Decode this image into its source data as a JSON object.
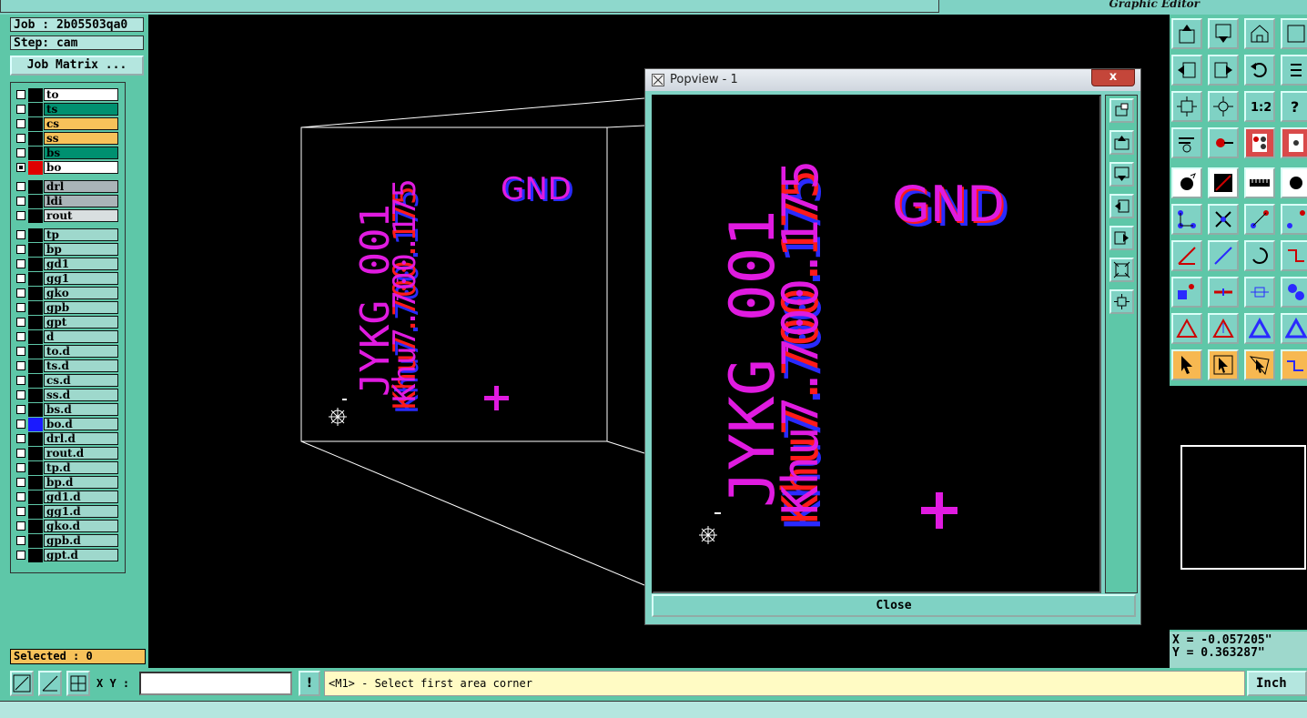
{
  "app": {
    "title": "Graphic Editor"
  },
  "job": {
    "job_label": "Job : 2b05503qa0",
    "step_label": "Step: cam",
    "matrix_button": "Job Matrix ..."
  },
  "layers": [
    {
      "name": "to",
      "bg": "#ffffff",
      "color": "#000000",
      "active": false
    },
    {
      "name": "ts",
      "bg": "#009070",
      "color": "#000000",
      "active": false
    },
    {
      "name": "cs",
      "bg": "#f7c25a",
      "color": "#000000",
      "active": false
    },
    {
      "name": "ss",
      "bg": "#f7c25a",
      "color": "#000000",
      "active": false
    },
    {
      "name": "bs",
      "bg": "#009070",
      "color": "#000000",
      "active": false
    },
    {
      "name": "bo",
      "bg": "#ffffff",
      "color": "#e00000",
      "active": true
    },
    {
      "name": "drl",
      "bg": "#aab4b8",
      "color": "#000000",
      "active": false
    },
    {
      "name": "ldi",
      "bg": "#aab4b8",
      "color": "#000000",
      "active": false
    },
    {
      "name": "rout",
      "bg": "#d9dfe0",
      "color": "#000000",
      "active": false
    },
    {
      "name": "tp",
      "bg": "#9ed8cc",
      "color": "#000000",
      "active": false
    },
    {
      "name": "bp",
      "bg": "#9ed8cc",
      "color": "#000000",
      "active": false
    },
    {
      "name": "gd1",
      "bg": "#9ed8cc",
      "color": "#000000",
      "active": false
    },
    {
      "name": "gg1",
      "bg": "#9ed8cc",
      "color": "#000000",
      "active": false
    },
    {
      "name": "gko",
      "bg": "#9ed8cc",
      "color": "#000000",
      "active": false
    },
    {
      "name": "gpb",
      "bg": "#9ed8cc",
      "color": "#000000",
      "active": false
    },
    {
      "name": "gpt",
      "bg": "#9ed8cc",
      "color": "#000000",
      "active": false
    },
    {
      "name": "d",
      "bg": "#9ed8cc",
      "color": "#000000",
      "active": false
    },
    {
      "name": "to.d",
      "bg": "#9ed8cc",
      "color": "#000000",
      "active": false
    },
    {
      "name": "ts.d",
      "bg": "#9ed8cc",
      "color": "#000000",
      "active": false
    },
    {
      "name": "cs.d",
      "bg": "#9ed8cc",
      "color": "#000000",
      "active": false
    },
    {
      "name": "ss.d",
      "bg": "#9ed8cc",
      "color": "#000000",
      "active": false
    },
    {
      "name": "bs.d",
      "bg": "#9ed8cc",
      "color": "#000000",
      "active": false
    },
    {
      "name": "bo.d",
      "bg": "#9ed8cc",
      "color": "#1a1aff",
      "active": false
    },
    {
      "name": "drl.d",
      "bg": "#9ed8cc",
      "color": "#000000",
      "active": false
    },
    {
      "name": "rout.d",
      "bg": "#9ed8cc",
      "color": "#000000",
      "active": false
    },
    {
      "name": "tp.d",
      "bg": "#9ed8cc",
      "color": "#000000",
      "active": false
    },
    {
      "name": "bp.d",
      "bg": "#9ed8cc",
      "color": "#000000",
      "active": false
    },
    {
      "name": "gd1.d",
      "bg": "#9ed8cc",
      "color": "#000000",
      "active": false
    },
    {
      "name": "gg1.d",
      "bg": "#9ed8cc",
      "color": "#000000",
      "active": false
    },
    {
      "name": "gko.d",
      "bg": "#9ed8cc",
      "color": "#000000",
      "active": false
    },
    {
      "name": "gpb.d",
      "bg": "#9ed8cc",
      "color": "#000000",
      "active": false
    },
    {
      "name": "gpt.d",
      "bg": "#9ed8cc",
      "color": "#000000",
      "active": false
    }
  ],
  "selected_label": "Selected : 0",
  "canvas": {
    "gnd_text": "GND",
    "part_text": "JYKG_001",
    "version_text": "Khu7.700.175"
  },
  "popview": {
    "title": "Popview - 1",
    "close_x": "x",
    "close_button": "Close"
  },
  "coords": {
    "x": "X = -0.057205\"",
    "y": "Y = 0.363287\""
  },
  "bottom": {
    "xy_label": "X Y :",
    "xy_value": "",
    "bang": "!",
    "status": "<M1> - Select first area corner",
    "units": "Inch"
  },
  "colors": {
    "magenta": "#e01be0",
    "red": "#ff1a1a",
    "blue": "#2a2aff",
    "panel": "#5ec7a8",
    "light_panel": "#b4e6df"
  }
}
